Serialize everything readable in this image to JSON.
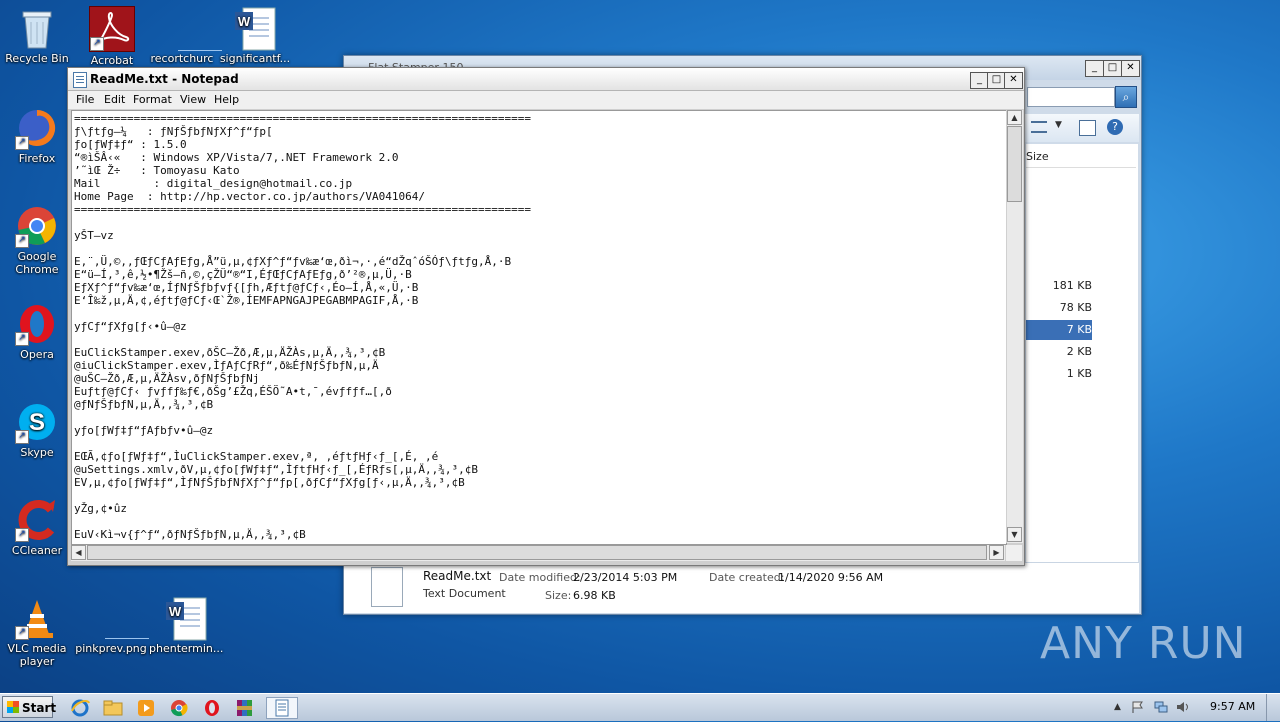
{
  "desktop": {
    "icons": [
      {
        "label": "Recycle Bin"
      },
      {
        "label": "Acrobat"
      },
      {
        "label": "recortchurc"
      },
      {
        "label": "significantf..."
      },
      {
        "label": "Firefox"
      },
      {
        "label": "Google Chrome"
      },
      {
        "label": "Opera"
      },
      {
        "label": "Skype"
      },
      {
        "label": "CCleaner"
      },
      {
        "label": "VLC media player"
      },
      {
        "label": "pinkprev.png"
      },
      {
        "label": "phentermin..."
      }
    ]
  },
  "explorer": {
    "title": "Flat Stamper 150",
    "column_size": "Size",
    "sizes": [
      "181 KB",
      "78 KB",
      "7 KB",
      "2 KB",
      "1 KB"
    ],
    "details": {
      "name": "ReadMe.txt",
      "type": "Text Document",
      "modified_label": "Date modified:",
      "modified": "2/23/2014 5:03 PM",
      "created_label": "Date created:",
      "created": "1/14/2020 9:56 AM",
      "size_label": "Size:",
      "size": "6.98 KB"
    }
  },
  "notepad": {
    "title": "ReadMe.txt - Notepad",
    "menu": {
      "file": "File",
      "edit": "Edit",
      "format": "Format",
      "view": "View",
      "help": "Help"
    },
    "text": "=====================================================================\nƒ\\ƒtƒg–¼   : ƒNƒŠƒbƒNƒXƒ^ƒ“ƒp[\nƒo[ƒWƒ‡ƒ“ : 1.5.0\n“®ìŠÂ‹«   : Windows XP/Vista/7,.NET Framework 2.0\n’˜ìŒ Ž÷   : Tomoyasu Kato\nMail        : digital_design@hotmail.co.jp\nHome Page  : http://hp.vector.co.jp/authors/VA041064/\n=====================================================================\n\nyŠT—vz\n\nE‚¨,Ü,©,‚ƒŒƒCƒAƒEƒg,Å”ü,µ,¢ƒXƒ^ƒ“ƒv‰æ‘œ,ðì¬,·,é“dŽqˆóŠÓƒ\\ƒtƒg,Å,·B\nE“ü—Í,³,ê,½•¶Žš—ñ,©,çŽÜ“®“I,ÉƒŒƒCƒAƒEƒg,ð’²®,µ,Ü,·B\nEƒXƒ^ƒ“ƒv‰æ‘œ,ÍƒNƒŠƒbƒvƒ{[ƒh,Æƒtƒ@ƒCƒ‹,Éo—Í,Å,«,Ü,·B\nE‘Î‰ž,µ,Ä,¢,éƒtƒ@ƒCƒ‹Œ`Ž®,ÍEMFAPNGAJPEGABMPAGIF,Å,·B\n\nyƒCƒ“ƒXƒg[ƒ‹•û–@z\n\nEuClickStamper.exev,ðŠC–Žð,Æ,µ,ÄŽÀs,µ,Ä,­,¾,³,¢B\n@iuClickStamper.exev,ÌƒAƒCƒRƒ“,ð‰ÉƒNƒŠƒbƒN,µ,Ä\n@uŠC–Žð,Æ,µ,ÄŽÀsv,ðƒNƒŠƒbƒNj\nEuƒtƒ@ƒCƒ‹ ƒvƒfƒ‰ƒ€,ðŠg’£Žq,ÉŠÖ˜A•t,¯,évƒfƒf…[,ð\n@ƒNƒŠƒbƒN,µ,Ä,­,¾,³,¢B\n\nyƒo[ƒWƒ‡ƒ“ƒAƒbƒv•û–@z\n\nEŒÃ,¢ƒo[ƒWƒ‡ƒ“,ÌuClickStamper.exev,ª, ,éƒtƒHƒ‹ƒ_[,É, ,é\n@uSettings.xmlv,ðV,µ,¢ƒo[ƒWƒ‡ƒ“,ÌƒtƒHƒ‹ƒ_[,ÉƒRƒs[,µ,Ä,­,¾,³,¢B\nEV,µ,¢ƒo[ƒWƒ‡ƒ“,ÌƒNƒŠƒbƒNƒXƒ^ƒ“ƒp[,ðƒCƒ“ƒXƒg[ƒ‹,µ,Ä,­,¾,³,¢B\n\nyŽg,¢•ûz\n\nEuV‹Kì¬v{ƒ^ƒ“,ðƒNƒŠƒbƒN,µ,Ä,­,¾,³,¢B"
  },
  "taskbar": {
    "start": "Start",
    "time": "9:57 AM"
  },
  "watermark": "ANY RUN"
}
